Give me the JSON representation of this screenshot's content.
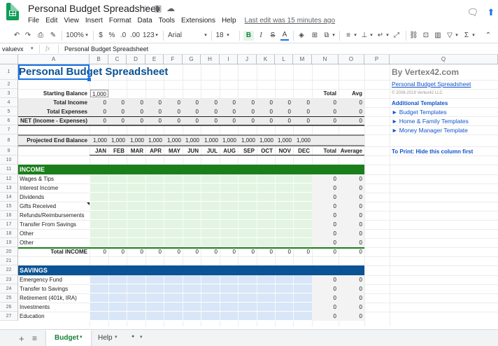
{
  "app": {
    "title": "Personal Budget Spreadsheet",
    "last_edit": "Last edit was 15 minutes ago"
  },
  "menu": [
    "File",
    "Edit",
    "View",
    "Insert",
    "Format",
    "Data",
    "Tools",
    "Extensions",
    "Help"
  ],
  "toolbar": {
    "zoom": "100%",
    "currency": "$",
    "percent": "%",
    "dec_less": ".0",
    "dec_more": ".00",
    "format": "123",
    "font": "Arial",
    "size": "18",
    "bold": "B",
    "italic": "I",
    "strike": "S",
    "text_color": "A"
  },
  "formula": {
    "namebox": "valuevx",
    "fx": "fx",
    "content": "Personal Budget Spreadsheet"
  },
  "columns": [
    "A",
    "B",
    "C",
    "D",
    "E",
    "F",
    "G",
    "H",
    "I",
    "J",
    "K",
    "L",
    "M",
    "N",
    "O",
    "P",
    "Q"
  ],
  "rows": [
    "1",
    "2",
    "3",
    "4",
    "5",
    "6",
    "7",
    "8",
    "9",
    "10",
    "11",
    "12",
    "13",
    "14",
    "15",
    "16",
    "17",
    "18",
    "19",
    "20",
    "21",
    "22",
    "23",
    "24",
    "25",
    "26",
    "27"
  ],
  "sheet": {
    "title": "Personal Budget Spreadsheet",
    "starting_balance_label": "Starting Balance",
    "starting_balance": "1,000",
    "total_hdr": "Total",
    "avg_hdr": "Avg",
    "summary": [
      {
        "label": "Total Income",
        "value": "0"
      },
      {
        "label": "Total Expenses",
        "value": "0"
      },
      {
        "label": "NET (Income - Expenses)",
        "value": "0"
      }
    ],
    "projected_label": "Projected End Balance",
    "projected": "1,000",
    "zero": "0",
    "months": [
      "JAN",
      "FEB",
      "MAR",
      "APR",
      "MAY",
      "JUN",
      "JUL",
      "AUG",
      "SEP",
      "OCT",
      "NOV",
      "DEC"
    ],
    "total_col": "Total",
    "average_col": "Average",
    "income_hdr": "INCOME",
    "income_items": [
      "Wages & Tips",
      "Interest Income",
      "Dividends",
      "Gifts Received",
      "Refunds/Reimbursements",
      "Transfer From Savings",
      "Other",
      "Other"
    ],
    "total_income_label": "Total INCOME",
    "savings_hdr": "SAVINGS",
    "savings_items": [
      "Emergency Fund",
      "Transfer to Savings",
      "Retirement (401k, IRA)",
      "Investments",
      "Education"
    ]
  },
  "side": {
    "brand": "By Vertex42.com",
    "link": "Personal Budget Spreadsheet",
    "copyright": "© 2008-2019 Vertex42 LLC",
    "additional": "Additional Templates",
    "links": [
      "► Budget Templates",
      "► Home & Family Templates",
      "► Money Manager Template"
    ],
    "print_note": "To Print: Hide this column first"
  },
  "tabs": {
    "add": "+",
    "list": "≡",
    "budget": "Budget",
    "help": "Help",
    "third": "▾"
  },
  "colors": {
    "income": "#1a7f1a",
    "savings": "#0b5394",
    "income_fill": "#e3f4e3",
    "savings_fill": "#d9e6f7",
    "link": "#1155cc",
    "title": "#0b5394"
  }
}
